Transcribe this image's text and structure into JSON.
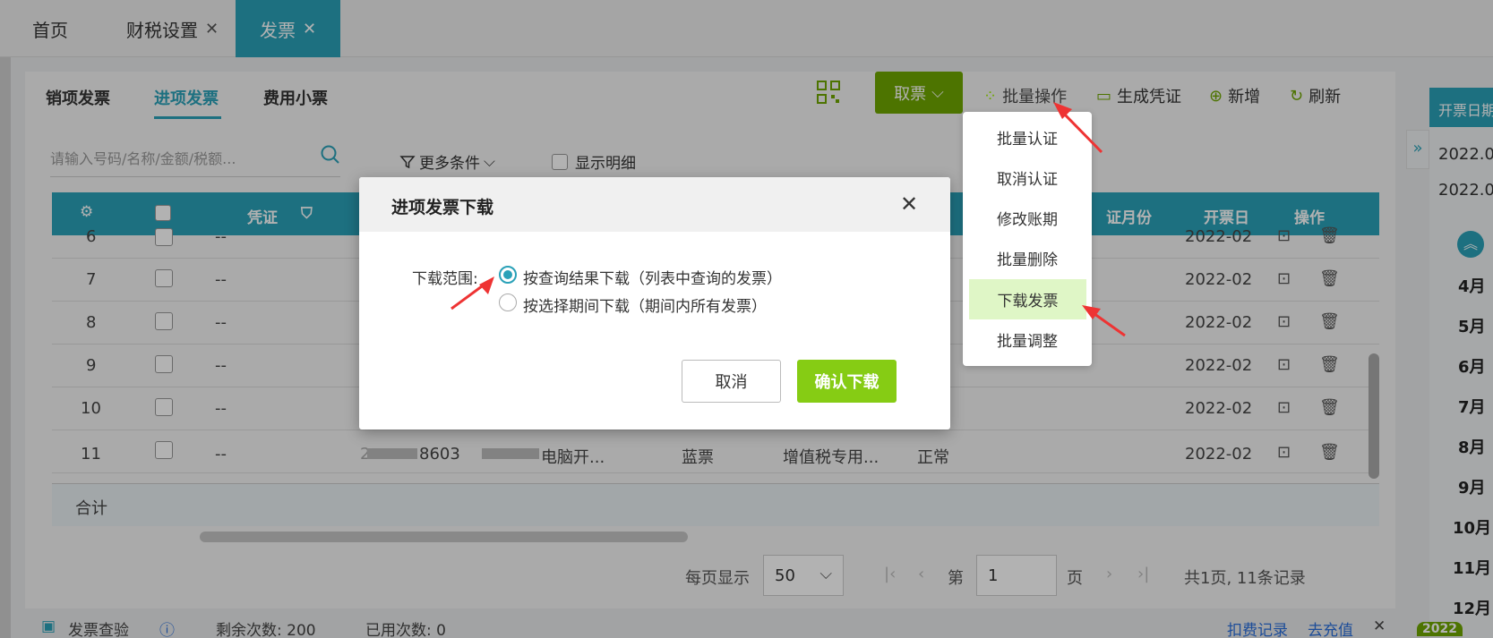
{
  "tabs": [
    {
      "label": "首页",
      "closable": false,
      "active": false
    },
    {
      "label": "财税设置",
      "closable": true,
      "active": false
    },
    {
      "label": "发票",
      "closable": true,
      "active": true
    }
  ],
  "subtabs": [
    "销项发票",
    "进项发票",
    "费用小票"
  ],
  "search": {
    "placeholder": "请输入号码/名称/金额/税额..."
  },
  "filter": {
    "more_label": "更多条件",
    "show_detail_label": "显示明细"
  },
  "toolbar": {
    "take_label": "取票",
    "batch_label": "批量操作",
    "voucher_label": "生成凭证",
    "add_label": "新增",
    "refresh_label": "刷新"
  },
  "batch_menu": {
    "items": [
      "批量认证",
      "取消认证",
      "修改账期",
      "批量删除",
      "下载发票",
      "批量调整"
    ],
    "highlighted": "下载发票"
  },
  "table": {
    "headers": {
      "voucher": "凭证",
      "period": "证月份",
      "date": "开票日",
      "ops": "操作"
    },
    "rows": [
      {
        "no": "6",
        "voucher": "--",
        "date": "2022-02"
      },
      {
        "no": "7",
        "voucher": "--",
        "date": "2022-02"
      },
      {
        "no": "8",
        "voucher": "--",
        "date": "2022-02"
      },
      {
        "no": "9",
        "voucher": "--",
        "date": "2022-02"
      },
      {
        "no": "10",
        "voucher": "--",
        "date": "2022-02"
      },
      {
        "no": "11",
        "voucher": "--",
        "code": "2",
        "code_tail": "8603",
        "seller_tail": "电脑开...",
        "color": "蓝票",
        "type": "增值税专用...",
        "status": "正常",
        "date": "2022-02"
      }
    ],
    "total_label": "合计"
  },
  "pager": {
    "per_page_label": "每页显示",
    "per_page": "50",
    "page_prefix": "第",
    "page": "1",
    "page_suffix": "页",
    "summary": "共1页, 11条记录"
  },
  "right_panel": {
    "header": "开票日期",
    "dates": [
      "2022.0",
      "2022.0"
    ],
    "months": [
      "4月",
      "5月",
      "6月",
      "7月",
      "8月",
      "9月",
      "10月",
      "11月",
      "12月"
    ],
    "year_badge": "2022"
  },
  "bottom": {
    "check_label": "发票查验",
    "remain": "剩余次数: 200",
    "used": "已用次数: 0",
    "record": "扣费记录",
    "recharge": "去充值"
  },
  "modal": {
    "title": "进项发票下载",
    "range_label": "下载范围:",
    "options": [
      {
        "label": "按查询结果下载（列表中查询的发票）",
        "selected": true
      },
      {
        "label": "按选择期间下载（期间内所有发票）",
        "selected": false
      }
    ],
    "cancel_label": "取消",
    "confirm_label": "确认下载"
  },
  "colors": {
    "accent": "#2aa1b8",
    "green": "#86cc14",
    "dark_green": "#6fa600",
    "highlight": "#dff6c6"
  }
}
